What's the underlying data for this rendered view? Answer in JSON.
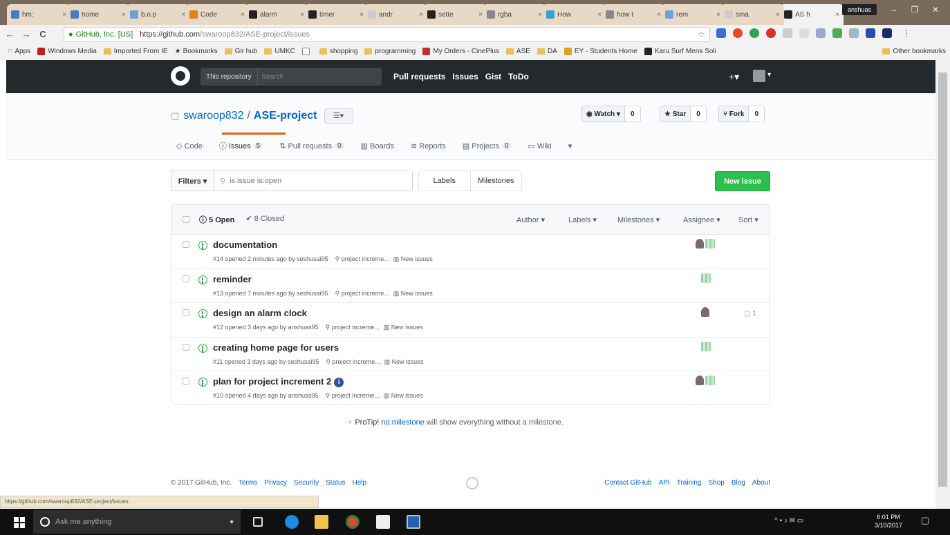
{
  "browser": {
    "tabs": [
      {
        "label": "hm:",
        "color": "#4a78c2"
      },
      {
        "label": "home",
        "color": "#4a78c2"
      },
      {
        "label": "b.o.p",
        "color": "#6ea0e0"
      },
      {
        "label": "Code",
        "color": "#e08020"
      },
      {
        "label": "alarm",
        "color": "#222222"
      },
      {
        "label": "timer",
        "color": "#222222"
      },
      {
        "label": "andr",
        "color": "#cccccc"
      },
      {
        "label": "sette",
        "color": "#222222"
      },
      {
        "label": "rgba",
        "color": "#888888"
      },
      {
        "label": "How",
        "color": "#3aa0d0"
      },
      {
        "label": "how t",
        "color": "#888888"
      },
      {
        "label": "rem",
        "color": "#6ea0e0"
      },
      {
        "label": "sma",
        "color": "#cccccc"
      },
      {
        "label": "AS h",
        "color": "#222222"
      }
    ],
    "tab_close": "×",
    "profile_label": "anshuas",
    "window_controls": [
      "–",
      "❐",
      "✕"
    ],
    "nav": {
      "back": "←",
      "forward": "→",
      "reload": "C"
    },
    "address": {
      "secure_label": "GitHub, Inc. [US]",
      "url_host": "https://github.com",
      "url_path": "/swaroop832/ASE-project/issues"
    },
    "star_icon": "☆",
    "bookmarks": [
      {
        "label": "Apps",
        "type": "apps"
      },
      {
        "label": "Windows Media",
        "type": "icon",
        "color": "#c02020"
      },
      {
        "label": "Imported From IE",
        "type": "folder"
      },
      {
        "label": "Bookmarks",
        "type": "star"
      },
      {
        "label": "Gir hub",
        "type": "folder"
      },
      {
        "label": "UMKC",
        "type": "folder"
      },
      {
        "label": "",
        "type": "doc"
      },
      {
        "label": "shopping",
        "type": "folder"
      },
      {
        "label": "programming",
        "type": "folder"
      },
      {
        "label": "My Orders - CinePlus",
        "type": "icon",
        "color": "#c03030"
      },
      {
        "label": "ASE",
        "type": "folder"
      },
      {
        "label": "DA",
        "type": "folder"
      },
      {
        "label": "EY - Students Home",
        "type": "icon",
        "color": "#e0a020"
      },
      {
        "label": "Karu Surf Mens Soli",
        "type": "icon",
        "color": "#222222"
      },
      {
        "label": "Other bookmarks",
        "type": "folder"
      }
    ]
  },
  "github": {
    "search_scope": "This repository",
    "search_placeholder": "Search",
    "nav": [
      "Pull requests",
      "Issues",
      "Gist",
      "ToDo"
    ],
    "plus": "+▾",
    "avatar_caret": "▾"
  },
  "repo": {
    "owner": "swaroop832",
    "separator": "/",
    "name": "ASE-project",
    "menu_icon": "☰▾",
    "watch": {
      "label": "◉ Watch ▾",
      "count": "0"
    },
    "star": {
      "label": "★ Star",
      "count": "0"
    },
    "fork": {
      "label": "⑂ Fork",
      "count": "0"
    },
    "tabs": [
      {
        "label": "◇ Code",
        "count": ""
      },
      {
        "label": "ⓘ Issues",
        "count": "5"
      },
      {
        "label": "⇅ Pull requests",
        "count": "0"
      },
      {
        "label": "▥ Boards",
        "count": ""
      },
      {
        "label": "≋ Reports",
        "count": ""
      },
      {
        "label": "▤ Projects",
        "count": "0"
      },
      {
        "label": "▭ Wiki",
        "count": ""
      },
      {
        "label": "▾",
        "count": ""
      }
    ]
  },
  "issues": {
    "filters_label": "Filters ▾",
    "search_value": "is:issue is:open",
    "labels_btn": "Labels",
    "milestones_btn": "Milestones",
    "new_issue": "New issue",
    "open_count": "ⓘ 5 Open",
    "closed_count": "✔ 8 Closed",
    "header_filters": [
      "Author ▾",
      "Labels ▾",
      "Milestones ▾",
      "Assignee ▾",
      "Sort ▾"
    ],
    "rows": [
      {
        "title": "documentation",
        "meta": "#14 opened 2 minutes ago by seshusai95",
        "milestone": "⚲ project increme...",
        "project": "▥ New issues",
        "assignees": "two",
        "comments": ""
      },
      {
        "title": "reminder",
        "meta": "#13 opened 7 minutes ago by seshusai95",
        "milestone": "⚲ project increme...",
        "project": "▥ New issues",
        "assignees": "one-green",
        "comments": ""
      },
      {
        "title": "design an alarm clock",
        "meta": "#12 opened 3 days ago by anshuas95",
        "milestone": "⚲ project increme...",
        "project": "▥ New issues",
        "assignees": "one-person",
        "comments": "▢ 1"
      },
      {
        "title": "creating home page for users",
        "meta": "#11 opened 3 days ago by seshusai95",
        "milestone": "⚲ project increme...",
        "project": "▥ New issues",
        "assignees": "one-green",
        "comments": ""
      },
      {
        "title": "plan for project increment 2",
        "meta": "#10 opened 4 days ago by anshuas95",
        "milestone": "⚲ project increme...",
        "project": "▥ New issues",
        "assignees": "two",
        "comments": "",
        "badge": "i"
      }
    ],
    "protip_label": "ProTip!",
    "protip_link": "no:milestone",
    "protip_text": "will show everything without a milestone."
  },
  "footer": {
    "copyright": "© 2017 GitHub, Inc.",
    "left_links": [
      "Terms",
      "Privacy",
      "Security",
      "Status",
      "Help"
    ],
    "right_links": [
      "Contact GitHub",
      "API",
      "Training",
      "Shop",
      "Blog",
      "About"
    ]
  },
  "status_url": "https://github.com/swaroop832/ASE-project/issues",
  "taskbar": {
    "search_placeholder": "Ask me anything",
    "mic": "♦",
    "tray_icons": "^ ▪ ♪ ✉ ▭",
    "time": "6:01 PM",
    "date": "3/10/2017",
    "notify": "▢"
  }
}
